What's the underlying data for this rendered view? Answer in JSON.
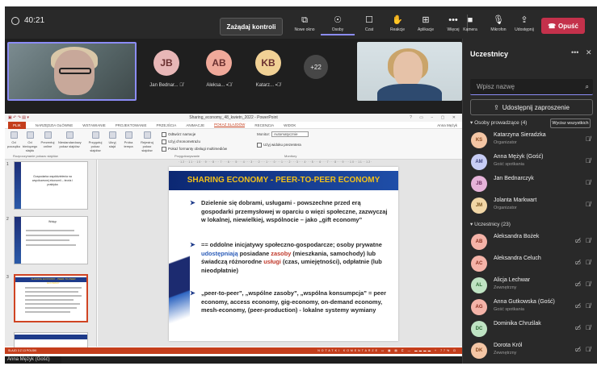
{
  "topbar": {
    "timer": "40:21",
    "control_label": "Zażądaj kontroli",
    "buttons": [
      {
        "label": "Nowe okno",
        "icon": "new-window-icon",
        "glyph": "⧉"
      },
      {
        "label": "Osoby",
        "icon": "people-icon",
        "glyph": "☉"
      },
      {
        "label": "Czat",
        "icon": "chat-icon",
        "glyph": "☐"
      },
      {
        "label": "Reakcje",
        "icon": "reactions-icon",
        "glyph": "✋"
      },
      {
        "label": "Aplikacje",
        "icon": "apps-icon",
        "glyph": "⊞"
      },
      {
        "label": "Więcej",
        "icon": "more-icon",
        "glyph": "•••"
      },
      {
        "label": "Kamera",
        "icon": "camera-icon",
        "glyph": "■"
      },
      {
        "label": "Mikrofon",
        "icon": "microphone-icon",
        "glyph": "🎙"
      },
      {
        "label": "Udostępnij",
        "icon": "share-screen-icon",
        "glyph": "⇪"
      }
    ],
    "leave_label": "Opuść"
  },
  "gallery": {
    "tiles": [
      {
        "initials": "JB",
        "name": "Jan Bednar...",
        "color": "#e8b7b7"
      },
      {
        "initials": "AB",
        "name": "Aleksa...",
        "color": "#f0a99a"
      },
      {
        "initials": "KB",
        "name": "Katarz...",
        "color": "#f1d195"
      }
    ],
    "more_count": "+22",
    "presenter_name": "Anna Mężyk (Gość)"
  },
  "ppt": {
    "window_title": "Sharing_economy_48_kwietn_2022 - PowerPoint",
    "user": "Anna Mężyk",
    "tabs": [
      "PLIK",
      "NARZĘDZIA GŁÓWNE",
      "WSTAWIANIE",
      "PROJEKTOWANIE",
      "PRZEJŚCIA",
      "ANIMACJE",
      "POKAZ SLAJDÓW",
      "RECENZJA",
      "WIDOK"
    ],
    "ribbon_buttons": [
      "Od początku",
      "Od bieżącego slajdu",
      "Prezentuj online",
      "Niestandardowy pokaz slajdów",
      "Przygotuj pokaz slajdów",
      "Ukryj slajd",
      "Próba tempa",
      "Rejestruj pokaz slajdów"
    ],
    "checks": [
      "Odtwórz narracje",
      "Użyj chronometrażu",
      "Pokaż formanty obsługi multimediów"
    ],
    "monitor_label": "Monitor:",
    "monitor_value": "Automatycznie",
    "presenter_view": "Użyj widoku prezentera",
    "groups": [
      "Rozpoczynanie pokazu slajdów",
      "Przygotowywanie",
      "Monitory"
    ],
    "thumbs": [
      {
        "n": "1",
        "text": "Gospodarka współdzielenia na współczesnej ekonomii – teoria i praktyka"
      },
      {
        "n": "2",
        "text": "Wstęp"
      },
      {
        "n": "3",
        "text": "SHARING ECONOMY - PEER-TO-PEER ECONOMY"
      }
    ],
    "ruler": "·12··11··10··9···8···7···6···5···4···3···2···1···0···1···2···3···4···5···6···7···8···9···10··11··12·",
    "slide": {
      "title": "SHARING ECONOMY  - PEER-TO-PEER ECONOMY",
      "b1": "Dzielenie się dobrami, usługami - powszechne przed erą gospodarki przemysłowej w oparciu o więzi społeczne, zazwyczaj w lokalnej, niewielkiej, wspólnocie – jako „gift economy”",
      "b2a": "== oddolne inicjatywy społeczno-gospodarcze; osoby prywatne ",
      "b2_hl1": "udostępniają",
      "b2b": " posiadane ",
      "b2_hl2": "zasoby",
      "b2c": " (mieszkania, samochody) lub świadczą różnorodne ",
      "b2_hl3": "usługi",
      "b2d": " (czas, umiejętności), odpłatnie (lub nieodpłatnie)",
      "b3": "„peer-to-peer”, „wspólne zasoby”, „wspólna konsumpcja” = peer economy, access economy, gig-economy, on-demand economy, mesh-economy, (peer-production) - lokalne systemy wymiany"
    },
    "status_left": "SLAJD 3 Z 13   POLSKI",
    "status_right": "NOTATKI   KOMENTARZE   ▭  ▦  ▤  ⊏  — ▬▬▬▬ +  77%  ⊡"
  },
  "panel": {
    "title": "Uczestnicy",
    "search_placeholder": "Wpisz nazwę",
    "share_label": "Udostępnij zaproszenie",
    "organizers_header": "Osoby prowadzące (4)",
    "mute_all": "Wycisz wszystkich",
    "attendees_header": "Uczestnicy (23)",
    "organizers": [
      {
        "initials": "KS",
        "name": "Katarzyna Sieradzka",
        "role": "Organizator",
        "bg": "#f4c6a5",
        "fg": "#8a4a20"
      },
      {
        "initials": "AM",
        "name": "Anna Mężyk (Gość)",
        "role": "Gość spotkania",
        "bg": "#c7cdf5",
        "fg": "#3a3f7a"
      },
      {
        "initials": "JB",
        "name": "Jan Bednarczyk",
        "role": "",
        "bg": "#e6b3d9",
        "fg": "#6a2d5e"
      },
      {
        "initials": "JM",
        "name": "Jolanta Markwart",
        "role": "Organizator",
        "bg": "#f1d6a6",
        "fg": "#7a5520"
      }
    ],
    "attendees": [
      {
        "initials": "AB",
        "name": "Aleksandra Bożek",
        "role": "",
        "bg": "#f4b3a8",
        "fg": "#8a3020"
      },
      {
        "initials": "AC",
        "name": "Aleksandra Celuch",
        "role": "",
        "bg": "#f4b3a8",
        "fg": "#8a3020"
      },
      {
        "initials": "AL",
        "name": "Alicja Lechwar",
        "role": "Zewnętrzny",
        "bg": "#bfe3c3",
        "fg": "#2e6b35"
      },
      {
        "initials": "AG",
        "name": "Anna Gutkowska (Gość)",
        "role": "Gość spotkania",
        "bg": "#f4b3a8",
        "fg": "#8a3020"
      },
      {
        "initials": "DC",
        "name": "Dominika Chruślak",
        "role": "",
        "bg": "#bfe3c3",
        "fg": "#2e6b35"
      },
      {
        "initials": "DK",
        "name": "Dorota Król",
        "role": "Zewnętrzny",
        "bg": "#f4c6a5",
        "fg": "#8a4a20"
      }
    ]
  }
}
